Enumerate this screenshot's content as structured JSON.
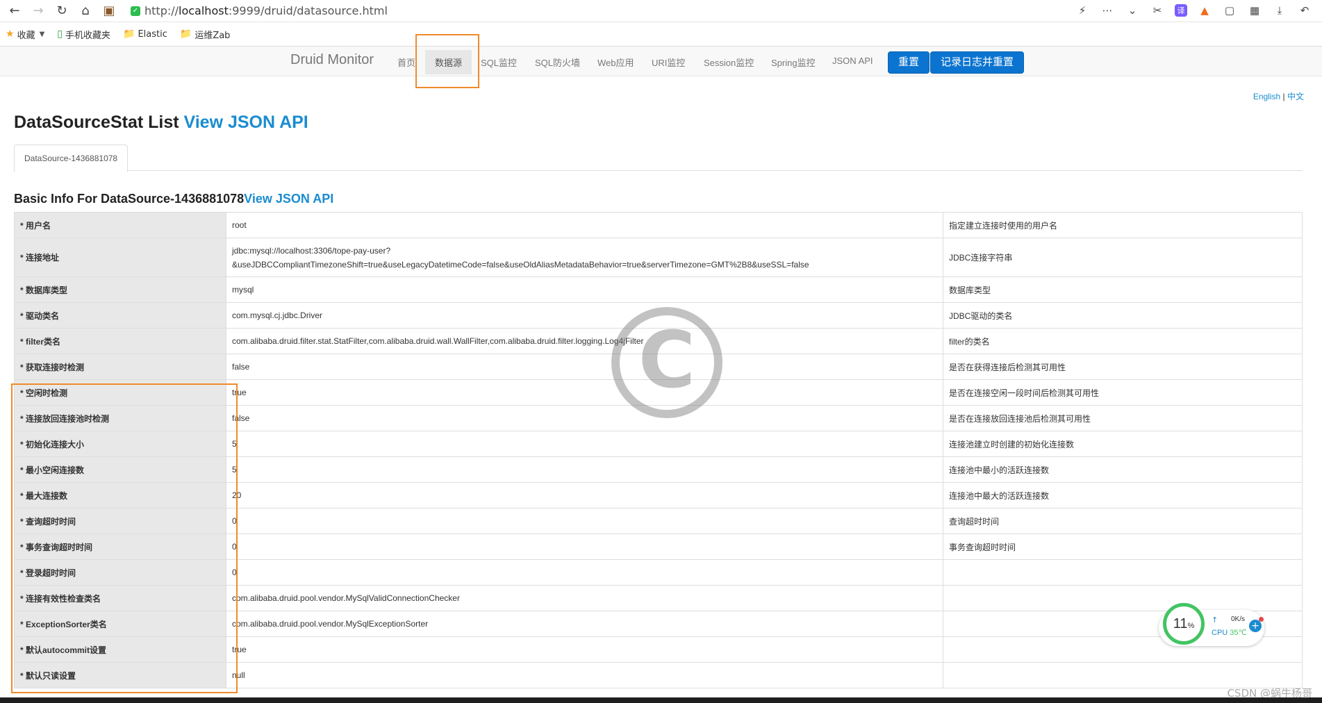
{
  "browser": {
    "url_prefix": "http://",
    "url_host": "localhost",
    "url_rest": ":9999/druid/datasource.html",
    "bookmarks": [
      {
        "label": "收藏",
        "icon": "star-icon"
      },
      {
        "label": "手机收藏夹",
        "icon": "phone-icon"
      },
      {
        "label": "Elastic",
        "icon": "folder-icon"
      },
      {
        "label": "运维Zab",
        "icon": "folder-icon"
      }
    ]
  },
  "nav": {
    "brand": "Druid Monitor",
    "items": [
      "首页",
      "数据源",
      "SQL监控",
      "SQL防火墙",
      "Web应用",
      "URI监控",
      "Session监控",
      "Spring监控",
      "JSON API"
    ],
    "reset_label": "重置",
    "log_reset_label": "记录日志并重置"
  },
  "lang": {
    "english": "English",
    "sep": "|",
    "chinese": "中文"
  },
  "page": {
    "title": "DataSourceStat List",
    "title_link": "View JSON API",
    "tab": "DataSource-1436881078",
    "section_title": "Basic Info For DataSource-1436881078",
    "section_link": "View JSON API"
  },
  "rows": [
    {
      "key": "* 用户名",
      "value": "root",
      "desc": "指定建立连接时使用的用户名"
    },
    {
      "key": "* 连接地址",
      "value": "jdbc:mysql://localhost:3306/tope-pay-user?",
      "value2": "&useJDBCCompliantTimezoneShift=true&useLegacyDatetimeCode=false&useOldAliasMetadataBehavior=true&serverTimezone=GMT%2B8&useSSL=false",
      "desc": "JDBC连接字符串"
    },
    {
      "key": "* 数据库类型",
      "value": "mysql",
      "desc": "数据库类型"
    },
    {
      "key": "* 驱动类名",
      "value": "com.mysql.cj.jdbc.Driver",
      "desc": "JDBC驱动的类名"
    },
    {
      "key": "* filter类名",
      "value": "com.alibaba.druid.filter.stat.StatFilter,com.alibaba.druid.wall.WallFilter,com.alibaba.druid.filter.logging.Log4jFilter",
      "desc": "filter的类名"
    },
    {
      "key": "* 获取连接时检测",
      "value": "false",
      "desc": "是否在获得连接后检测其可用性"
    },
    {
      "key": "* 空闲时检测",
      "value": "true",
      "desc": "是否在连接空闲一段时间后检测其可用性"
    },
    {
      "key": "* 连接放回连接池时检测",
      "value": "false",
      "desc": "是否在连接放回连接池后检测其可用性"
    },
    {
      "key": "* 初始化连接大小",
      "value": "5",
      "desc": "连接池建立时创建的初始化连接数"
    },
    {
      "key": "* 最小空闲连接数",
      "value": "5",
      "desc": "连接池中最小的活跃连接数"
    },
    {
      "key": "* 最大连接数",
      "value": "20",
      "desc": "连接池中最大的活跃连接数"
    },
    {
      "key": "* 查询超时时间",
      "value": "0",
      "desc": "查询超时时间"
    },
    {
      "key": "* 事务查询超时时间",
      "value": "0",
      "desc": "事务查询超时时间"
    },
    {
      "key": "* 登录超时时间",
      "value": "0",
      "desc": ""
    },
    {
      "key": "* 连接有效性检查类名",
      "value": "com.alibaba.druid.pool.vendor.MySqlValidConnectionChecker",
      "desc": ""
    },
    {
      "key": "* ExceptionSorter类名",
      "value": "com.alibaba.druid.pool.vendor.MySqlExceptionSorter",
      "desc": ""
    },
    {
      "key": "* 默认autocommit设置",
      "value": "true",
      "desc": ""
    },
    {
      "key": "* 默认只读设置",
      "value": "null",
      "desc": ""
    }
  ],
  "widget": {
    "cpu_percent": "11",
    "percent_sign": "%",
    "net_speed": "0K/s",
    "cpu_label": "CPU",
    "cpu_temp": "35℃"
  },
  "watermark_text": "CSDN @蜗牛杨哥"
}
